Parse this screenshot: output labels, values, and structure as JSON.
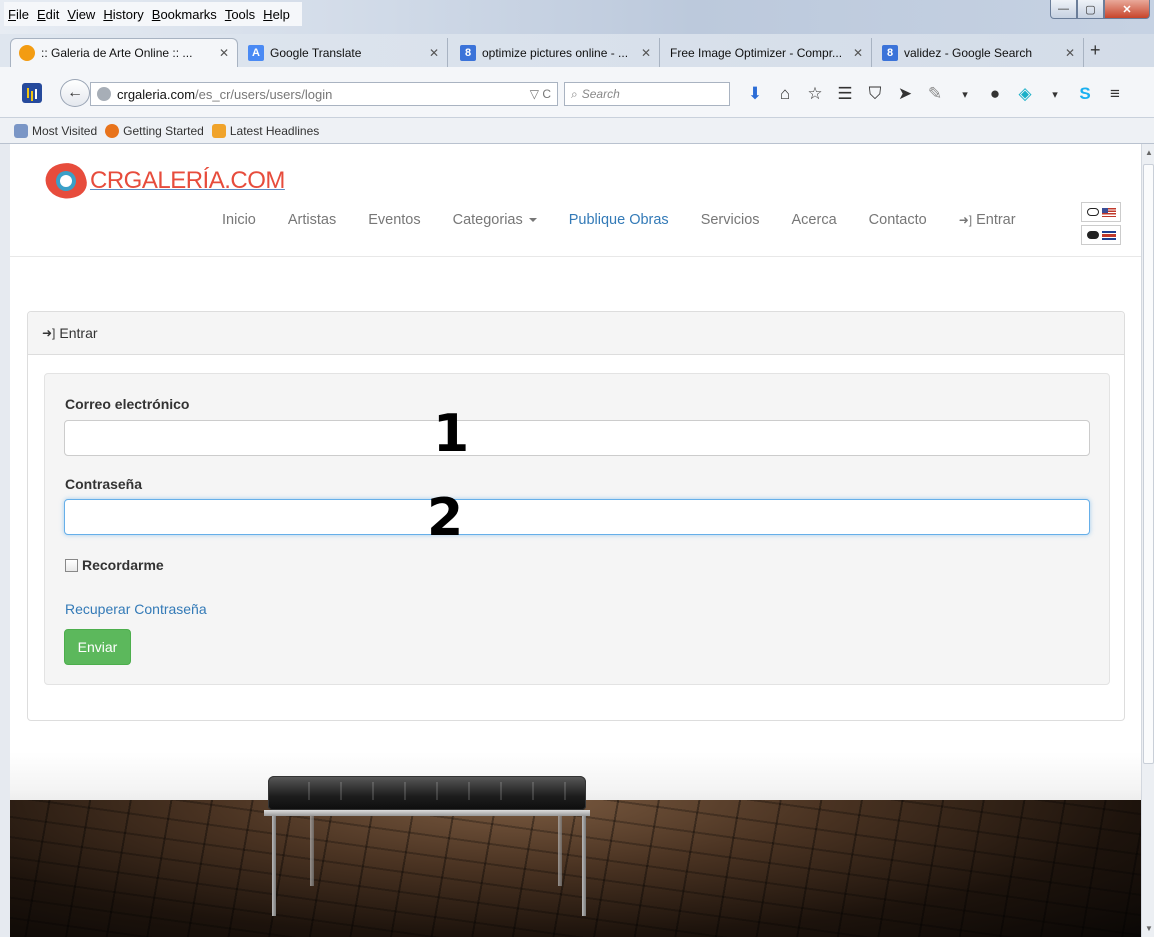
{
  "menubar": {
    "items": [
      "File",
      "Edit",
      "View",
      "History",
      "Bookmarks",
      "Tools",
      "Help"
    ]
  },
  "tabs": [
    {
      "title": ":: Galeria de Arte Online :: ...",
      "active": true
    },
    {
      "title": "Google Translate"
    },
    {
      "title": "optimize pictures online - ..."
    },
    {
      "title": "Free Image Optimizer - Compr..."
    },
    {
      "title": "validez - Google Search"
    }
  ],
  "address": {
    "host": "crgaleria.com",
    "path": "/es_cr/users/users/login",
    "search_placeholder": "Search"
  },
  "bookmarks": [
    "Most Visited",
    "Getting Started",
    "Latest Headlines"
  ],
  "site": {
    "logo_text": "CRGALERÍA.COM",
    "nav": {
      "inicio": "Inicio",
      "artistas": "Artistas",
      "eventos": "Eventos",
      "categorias": "Categorias",
      "publique": "Publique Obras",
      "servicios": "Servicios",
      "acerca": "Acerca",
      "contacto": "Contacto",
      "entrar": "Entrar"
    }
  },
  "login": {
    "heading": "Entrar",
    "email_label": "Correo electrónico",
    "password_label": "Contraseña",
    "remember_label": "Recordarme",
    "recover_link": "Recuperar Contraseña",
    "submit_label": "Enviar",
    "annotation_1": "1",
    "annotation_2": "2"
  },
  "colors": {
    "link": "#337ab7",
    "brand_red": "#e74c3c",
    "submit_green": "#5cb85c"
  }
}
